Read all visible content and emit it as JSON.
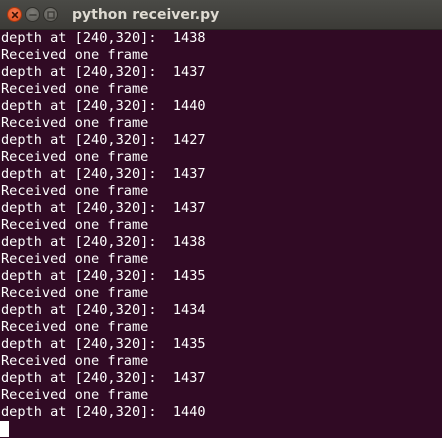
{
  "window": {
    "title": "python receiver.py"
  },
  "terminal": {
    "lines": [
      "depth at [240,320]:  1438",
      "Received one frame",
      "depth at [240,320]:  1437",
      "Received one frame",
      "depth at [240,320]:  1440",
      "Received one frame",
      "depth at [240,320]:  1427",
      "Received one frame",
      "depth at [240,320]:  1437",
      "Received one frame",
      "depth at [240,320]:  1437",
      "Received one frame",
      "depth at [240,320]:  1438",
      "Received one frame",
      "depth at [240,320]:  1435",
      "Received one frame",
      "depth at [240,320]:  1434",
      "Received one frame",
      "depth at [240,320]:  1435",
      "Received one frame",
      "depth at [240,320]:  1437",
      "Received one frame",
      "depth at [240,320]:  1440"
    ]
  },
  "colors": {
    "terminal_background": "#300a24",
    "terminal_text": "#ffffff",
    "titlebar": "#3c3b37",
    "close_button": "#df4a16"
  },
  "icons": {
    "close": "close-icon",
    "minimize": "minimize-icon",
    "maximize": "maximize-icon"
  }
}
